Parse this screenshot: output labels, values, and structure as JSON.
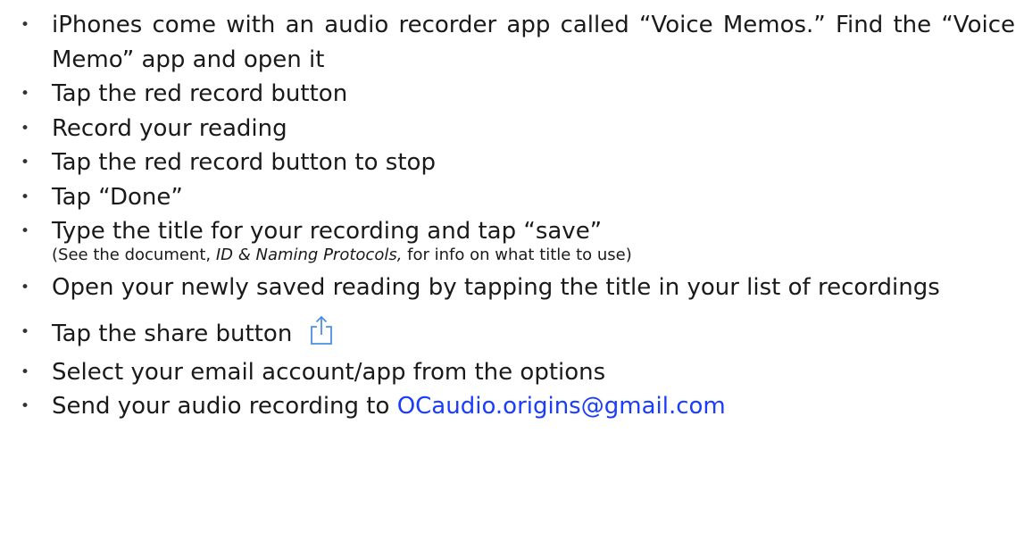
{
  "steps": [
    {
      "text": "iPhones come with an audio recorder app called “Voice Memos.” Find the “Voice Memo” app and open it"
    },
    {
      "text": "Tap the red record button"
    },
    {
      "text": "Record your reading"
    },
    {
      "text": "Tap the red record button to stop"
    },
    {
      "text": "Tap “Done”"
    },
    {
      "text": "Type the title for your recording and tap “save”",
      "note_prefix": "(See the document, ",
      "note_doc_title": "ID & Naming Protocols,",
      "note_suffix": " for info on what title to use)"
    },
    {
      "text": "Open your newly saved reading by tapping the title in your list of recordings"
    },
    {
      "text": "Tap the share button",
      "icon": "share-icon"
    },
    {
      "text": "Select your email account/app from the options"
    },
    {
      "text": "Send your audio recording to ",
      "email": "OCaudio.origins@gmail.com"
    }
  ],
  "colors": {
    "text": "#1a1a1a",
    "link": "#1a3cff",
    "share_icon": "#4a90e2"
  }
}
